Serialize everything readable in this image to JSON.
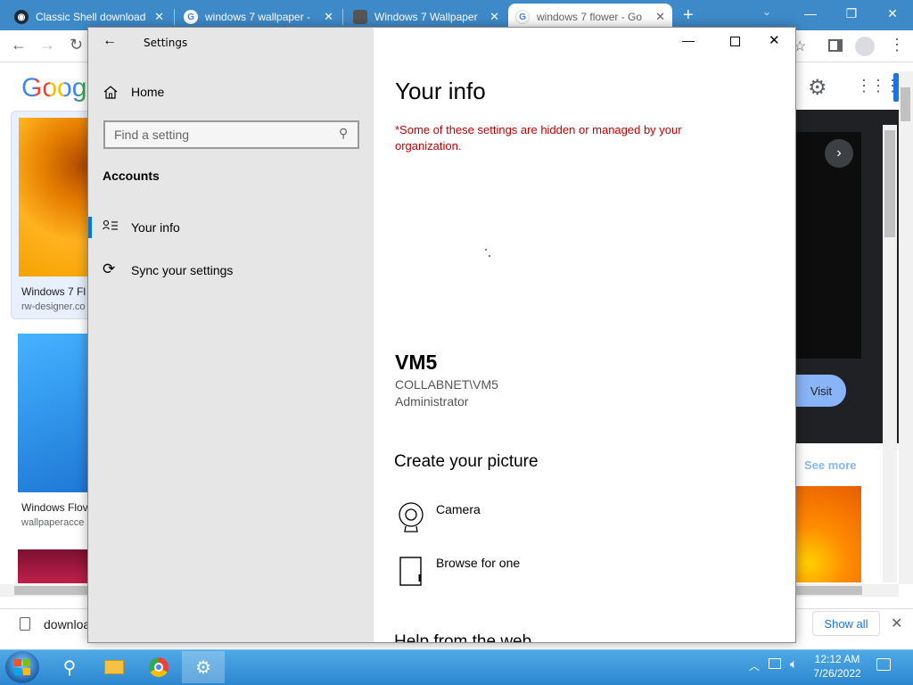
{
  "browser": {
    "tabs": [
      {
        "title": "Classic Shell download",
        "icon": "classic-shell-icon"
      },
      {
        "title": "windows 7 wallpaper -",
        "icon": "google-icon"
      },
      {
        "title": "Windows 7 Wallpaper",
        "icon": "wallpaper-site-icon"
      },
      {
        "title": "windows 7 flower - Go",
        "icon": "google-icon"
      }
    ],
    "new_tab": "+",
    "google_logo": "Googl",
    "results": [
      {
        "caption": "Windows 7 Fl",
        "source": "rw-designer.co"
      },
      {
        "caption": "Windows Flov",
        "source": "wallpaperacce"
      }
    ],
    "visit_label": "Visit",
    "see_more_label": "See more",
    "download": {
      "file": "downloa",
      "show_all": "Show all"
    }
  },
  "settings": {
    "window_title": "Settings",
    "home_label": "Home",
    "search_placeholder": "Find a setting",
    "section_heading": "Accounts",
    "nav": [
      {
        "label": "Your info",
        "icon": "person-list-icon",
        "selected": true
      },
      {
        "label": "Sync your settings",
        "icon": "sync-icon",
        "selected": false
      }
    ],
    "page_title": "Your info",
    "notice": "*Some of these settings are hidden or managed by your organization.",
    "user": {
      "name": "VM5",
      "account": "COLLABNET\\VM5",
      "role": "Administrator"
    },
    "picture_heading": "Create your picture",
    "picture_options": [
      {
        "label": "Camera",
        "icon": "camera-icon"
      },
      {
        "label": "Browse for one",
        "icon": "file-icon"
      }
    ],
    "help_heading": "Help from the web"
  },
  "taskbar": {
    "time": "12:12 AM",
    "date": "7/26/2022"
  },
  "colors": {
    "chrome_tabstrip": "#3e8ac9",
    "notice_red": "#c00000",
    "accent_blue": "#0078d7",
    "taskbar": "#2d87cf"
  }
}
